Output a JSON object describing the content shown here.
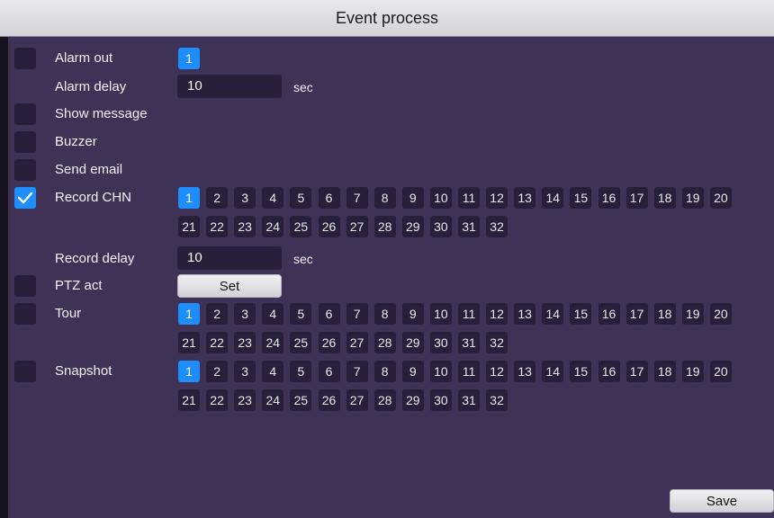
{
  "window": {
    "title": "Event process"
  },
  "rows": {
    "alarm_out": {
      "label": "Alarm out",
      "checked": false,
      "channels": [
        "1"
      ]
    },
    "alarm_delay": {
      "label": "Alarm delay",
      "value": "10",
      "unit": "sec"
    },
    "show_message": {
      "label": "Show message",
      "checked": false
    },
    "buzzer": {
      "label": "Buzzer",
      "checked": false
    },
    "send_email": {
      "label": "Send email",
      "checked": true
    },
    "record_chn": {
      "label": "Record CHN",
      "checked": true,
      "selected": [
        "1"
      ]
    },
    "record_delay": {
      "label": "Record delay",
      "value": "10",
      "unit": "sec"
    },
    "ptz_act": {
      "label": "PTZ act",
      "checked": false,
      "button": "Set"
    },
    "tour": {
      "label": "Tour",
      "checked": false,
      "selected": [
        "1"
      ]
    },
    "snapshot": {
      "label": "Snapshot",
      "checked": false,
      "selected": [
        "1"
      ]
    }
  },
  "channels": [
    "1",
    "2",
    "3",
    "4",
    "5",
    "6",
    "7",
    "8",
    "9",
    "10",
    "11",
    "12",
    "13",
    "14",
    "15",
    "16",
    "17",
    "18",
    "19",
    "20",
    "21",
    "22",
    "23",
    "24",
    "25",
    "26",
    "27",
    "28",
    "29",
    "30",
    "31",
    "32"
  ],
  "footer": {
    "save_label": "Save"
  },
  "colors": {
    "background": "#3e3357",
    "control": "#28203b",
    "accent": "#1e8eff",
    "titlebar": "#e0e0e3"
  }
}
